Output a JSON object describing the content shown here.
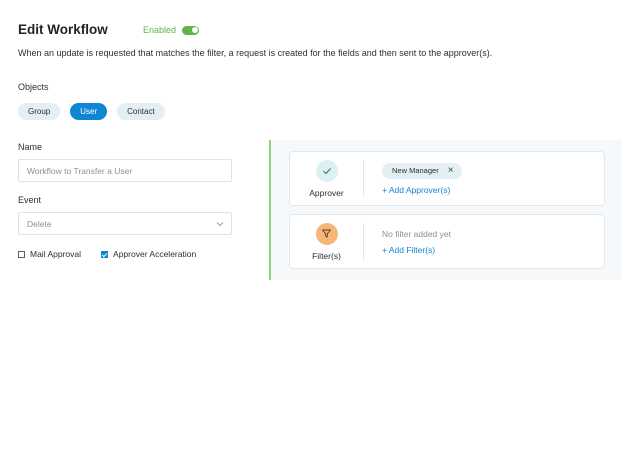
{
  "header": {
    "title": "Edit Workflow",
    "status_label": "Enabled",
    "status_on": true
  },
  "description": "When an update is requested that matches the filter, a request is created for the fields and then sent to the approver(s).",
  "objects": {
    "label": "Objects",
    "items": [
      {
        "label": "Group",
        "selected": false
      },
      {
        "label": "User",
        "selected": true
      },
      {
        "label": "Contact",
        "selected": false
      }
    ]
  },
  "form": {
    "name_label": "Name",
    "name_value": "Workflow to Transfer a User",
    "event_label": "Event",
    "event_value": "Delete",
    "mail_approval_label": "Mail Approval",
    "mail_approval_checked": false,
    "approver_acceleration_label": "Approver Acceleration",
    "approver_acceleration_checked": true
  },
  "approver_card": {
    "label": "Approver",
    "icon": "check-icon",
    "tags": [
      "New Manager"
    ],
    "add_link": "+ Add Approver(s)"
  },
  "filter_card": {
    "label": "Filter(s)",
    "icon": "filter-icon",
    "empty_text": "No filter added yet",
    "add_link": "+ Add Filter(s)"
  },
  "colors": {
    "accent": "#0e86d4",
    "enabled_green": "#5fb54a",
    "filter_orange": "#f7b679"
  }
}
